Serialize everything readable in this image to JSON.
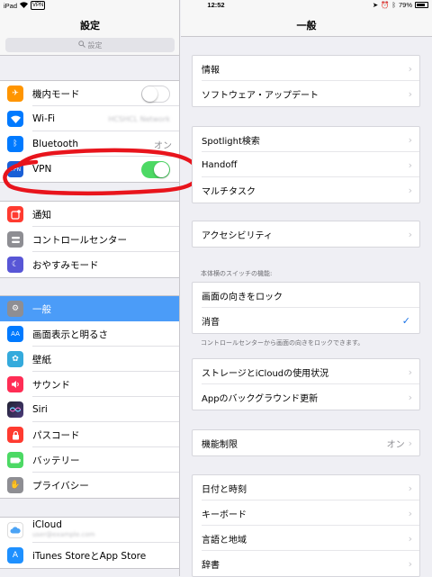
{
  "status_bar": {
    "device": "iPad",
    "vpn": "VPN",
    "time": "12:52",
    "battery": "79%"
  },
  "master": {
    "title": "設定",
    "search_placeholder": "設定",
    "groups": [
      [
        {
          "label": "機内モード",
          "icon": "airplane-icon",
          "color": "#ff9500",
          "control": "toggle-off"
        },
        {
          "label": "Wi-Fi",
          "icon": "wifi-icon",
          "color": "#007aff",
          "value": "HCSHCL Network",
          "blurred": true
        },
        {
          "label": "Bluetooth",
          "icon": "bluetooth-icon",
          "color": "#007aff",
          "value": "オン"
        },
        {
          "label": "VPN",
          "icon": "vpn-icon",
          "color": "#1a5fd6",
          "control": "toggle-on"
        }
      ],
      [
        {
          "label": "通知",
          "icon": "notification-icon",
          "color": "#ff3b30"
        },
        {
          "label": "コントロールセンター",
          "icon": "control-center-icon",
          "color": "#8e8e93"
        },
        {
          "label": "おやすみモード",
          "icon": "moon-icon",
          "color": "#5856d6"
        }
      ],
      [
        {
          "label": "一般",
          "icon": "gear-icon",
          "color": "#8e8e93",
          "selected": true
        },
        {
          "label": "画面表示と明るさ",
          "icon": "display-icon",
          "color": "#007aff"
        },
        {
          "label": "壁紙",
          "icon": "wallpaper-icon",
          "color": "#34aadc"
        },
        {
          "label": "サウンド",
          "icon": "sound-icon",
          "color": "#ff2d55"
        },
        {
          "label": "Siri",
          "icon": "siri-icon",
          "color": "#222233"
        },
        {
          "label": "パスコード",
          "icon": "lock-icon",
          "color": "#ff3b30"
        },
        {
          "label": "バッテリー",
          "icon": "battery-icon",
          "color": "#4cd964"
        },
        {
          "label": "プライバシー",
          "icon": "hand-icon",
          "color": "#8e8e93"
        }
      ],
      [
        {
          "label": "iCloud",
          "icon": "icloud-icon",
          "color": "#ffffff",
          "value": "user@example.com",
          "blurred": true
        },
        {
          "label": "iTunes StoreとApp Store",
          "icon": "app-store-icon",
          "color": "#1e90ff"
        }
      ]
    ]
  },
  "detail": {
    "title": "一般",
    "groups": [
      {
        "rows": [
          {
            "label": "情報",
            "accessory": "chevron"
          },
          {
            "label": "ソフトウェア・アップデート",
            "accessory": "chevron"
          }
        ]
      },
      {
        "rows": [
          {
            "label": "Spotlight検索",
            "accessory": "chevron"
          },
          {
            "label": "Handoff",
            "accessory": "chevron"
          },
          {
            "label": "マルチタスク",
            "accessory": "chevron"
          }
        ]
      },
      {
        "rows": [
          {
            "label": "アクセシビリティ",
            "accessory": "chevron"
          }
        ]
      },
      {
        "header": "本体横のスイッチの機能:",
        "footer": "コントロールセンターから画面の向きをロックできます。",
        "rows": [
          {
            "label": "画面の向きをロック",
            "accessory": "none"
          },
          {
            "label": "消音",
            "accessory": "check"
          }
        ]
      },
      {
        "rows": [
          {
            "label": "ストレージとiCloudの使用状況",
            "accessory": "chevron"
          },
          {
            "label": "Appのバックグラウンド更新",
            "accessory": "chevron"
          }
        ]
      },
      {
        "rows": [
          {
            "label": "機能制限",
            "value": "オン",
            "accessory": "chevron"
          }
        ]
      },
      {
        "rows": [
          {
            "label": "日付と時刻",
            "accessory": "chevron"
          },
          {
            "label": "キーボード",
            "accessory": "chevron"
          },
          {
            "label": "言語と地域",
            "accessory": "chevron"
          },
          {
            "label": "辞書",
            "accessory": "chevron"
          }
        ]
      }
    ]
  },
  "annotation_color": "#e8141c"
}
